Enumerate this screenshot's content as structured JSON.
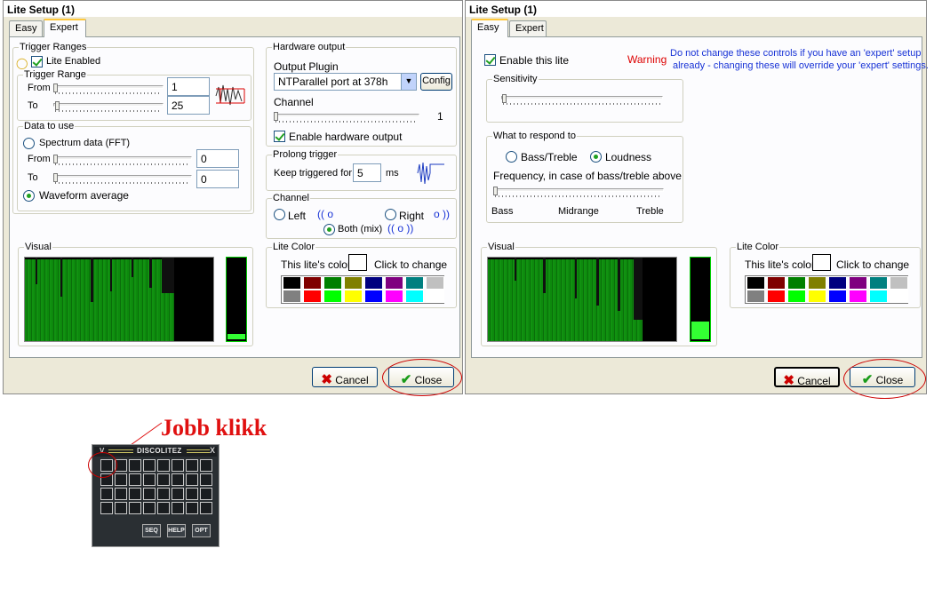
{
  "left": {
    "title": "Lite Setup (1)",
    "tabs": [
      "Easy",
      "Expert"
    ],
    "trigger_ranges": "Trigger Ranges",
    "lite_enabled": "Lite Enabled",
    "trigger_range": "Trigger Range",
    "from": "From",
    "to": "To",
    "from_val": "1",
    "to_val": "25",
    "data_to_use": "Data to use",
    "spectrum": "Spectrum data (FFT)",
    "from2_val": "0",
    "to2_val": "0",
    "waveform": "Waveform average",
    "hardware_output": "Hardware output",
    "output_plugin": "Output Plugin",
    "plugin_value": "NTParallel port at 378h",
    "config": "Config",
    "channel": "Channel",
    "channel_val": "1",
    "enable_hw": "Enable hardware output",
    "prolong": "Prolong trigger",
    "keep_triggered": "Keep triggered for",
    "keep_val": "5",
    "ms": "ms",
    "channel2": "Channel",
    "left": "Left",
    "right": "Right",
    "both": "Both (mix)",
    "left_sym": "(( o",
    "right_sym": "o ))",
    "both_sym": "(( o ))",
    "visual": "Visual",
    "lite_color": "Lite Color",
    "this_color": "This lite's color:",
    "click_change": "Click to change",
    "cancel": "Cancel",
    "close": "Close"
  },
  "right": {
    "title": "Lite Setup (1)",
    "tabs": [
      "Easy",
      "Expert"
    ],
    "enable_lite": "Enable this lite",
    "warning": "Warning",
    "warning_text_1": "Do not change these controls if you have an 'expert' setup",
    "warning_text_2": "already - changing these will override your 'expert' settings.",
    "sensitivity": "Sensitivity",
    "respond": "What to respond to",
    "bass_treble": "Bass/Treble",
    "loudness": "Loudness",
    "frequency": "Frequency, in case of bass/treble above",
    "bass": "Bass",
    "midrange": "Midrange",
    "treble": "Treble",
    "visual": "Visual",
    "lite_color": "Lite Color",
    "this_color": "This lite's color:",
    "click_change": "Click to change",
    "cancel": "Cancel",
    "close": "Close"
  },
  "palette": [
    "#000000",
    "#800000",
    "#008000",
    "#808000",
    "#000080",
    "#800080",
    "#008080",
    "#c0c0c0",
    "#808080",
    "#ff0000",
    "#00ff00",
    "#ffff00",
    "#0000ff",
    "#ff00ff",
    "#00ffff",
    "#ffffff"
  ],
  "annotation": "Jobb klikk",
  "disco": {
    "title": "DISCOLITEZ",
    "close_x": "X",
    "menu": "V",
    "seq": "SEQ",
    "help": "HELP",
    "opt": "OPT"
  }
}
